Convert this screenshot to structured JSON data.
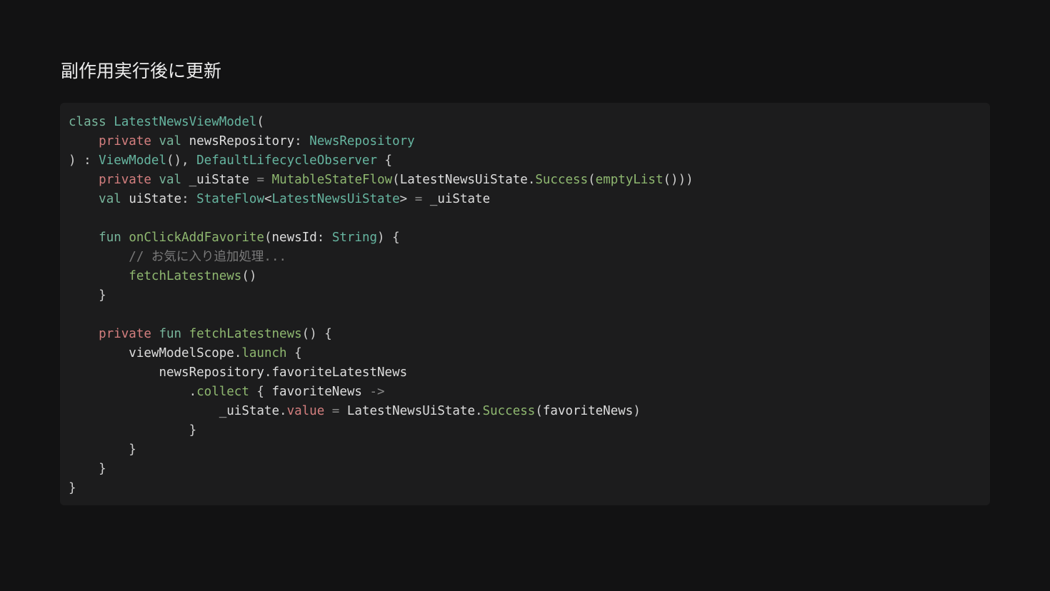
{
  "slide": {
    "title": "副作用実行後に更新"
  },
  "code": {
    "language": "kotlin",
    "colors": {
      "background": "#1c1c1d",
      "page_background": "#121213",
      "keyword_modifier": "#d47f7f",
      "keyword": "#77b59b",
      "type": "#66b5a0",
      "function": "#8fb870",
      "identifier": "#dedede",
      "operator": "#888888",
      "comment": "#7a7a7a"
    },
    "lines": [
      [
        {
          "t": "kw2",
          "v": "class"
        },
        {
          "t": "ws",
          "v": " "
        },
        {
          "t": "type",
          "v": "LatestNewsViewModel"
        },
        {
          "t": "punct",
          "v": "("
        }
      ],
      [
        {
          "t": "ws",
          "v": "    "
        },
        {
          "t": "kw",
          "v": "private"
        },
        {
          "t": "ws",
          "v": " "
        },
        {
          "t": "kw2",
          "v": "val"
        },
        {
          "t": "ws",
          "v": " "
        },
        {
          "t": "ident",
          "v": "newsRepository"
        },
        {
          "t": "punct",
          "v": ": "
        },
        {
          "t": "type",
          "v": "NewsRepository"
        }
      ],
      [
        {
          "t": "punct",
          "v": ") : "
        },
        {
          "t": "type",
          "v": "ViewModel"
        },
        {
          "t": "punct",
          "v": "(), "
        },
        {
          "t": "type",
          "v": "DefaultLifecycleObserver"
        },
        {
          "t": "punct",
          "v": " {"
        }
      ],
      [
        {
          "t": "ws",
          "v": "    "
        },
        {
          "t": "kw",
          "v": "private"
        },
        {
          "t": "ws",
          "v": " "
        },
        {
          "t": "kw2",
          "v": "val"
        },
        {
          "t": "ws",
          "v": " "
        },
        {
          "t": "ident",
          "v": "_uiState"
        },
        {
          "t": "ws",
          "v": " "
        },
        {
          "t": "op",
          "v": "="
        },
        {
          "t": "ws",
          "v": " "
        },
        {
          "t": "fn",
          "v": "MutableStateFlow"
        },
        {
          "t": "punct",
          "v": "("
        },
        {
          "t": "ident",
          "v": "LatestNewsUiState"
        },
        {
          "t": "punct",
          "v": "."
        },
        {
          "t": "fn",
          "v": "Success"
        },
        {
          "t": "punct",
          "v": "("
        },
        {
          "t": "fn",
          "v": "emptyList"
        },
        {
          "t": "punct",
          "v": "()))"
        }
      ],
      [
        {
          "t": "ws",
          "v": "    "
        },
        {
          "t": "kw2",
          "v": "val"
        },
        {
          "t": "ws",
          "v": " "
        },
        {
          "t": "ident",
          "v": "uiState"
        },
        {
          "t": "punct",
          "v": ": "
        },
        {
          "t": "type",
          "v": "StateFlow"
        },
        {
          "t": "punct",
          "v": "<"
        },
        {
          "t": "type",
          "v": "LatestNewsUiState"
        },
        {
          "t": "punct",
          "v": "> "
        },
        {
          "t": "op",
          "v": "="
        },
        {
          "t": "ws",
          "v": " "
        },
        {
          "t": "ident",
          "v": "_uiState"
        }
      ],
      [],
      [
        {
          "t": "ws",
          "v": "    "
        },
        {
          "t": "kw2",
          "v": "fun"
        },
        {
          "t": "ws",
          "v": " "
        },
        {
          "t": "fn",
          "v": "onClickAddFavorite"
        },
        {
          "t": "punct",
          "v": "("
        },
        {
          "t": "ident",
          "v": "newsId"
        },
        {
          "t": "punct",
          "v": ": "
        },
        {
          "t": "type",
          "v": "String"
        },
        {
          "t": "punct",
          "v": ") {"
        }
      ],
      [
        {
          "t": "ws",
          "v": "        "
        },
        {
          "t": "comment",
          "v": "// お気に入り追加処理..."
        }
      ],
      [
        {
          "t": "ws",
          "v": "        "
        },
        {
          "t": "fn",
          "v": "fetchLatestnews"
        },
        {
          "t": "punct",
          "v": "()"
        }
      ],
      [
        {
          "t": "ws",
          "v": "    "
        },
        {
          "t": "punct",
          "v": "}"
        }
      ],
      [],
      [
        {
          "t": "ws",
          "v": "    "
        },
        {
          "t": "kw",
          "v": "private"
        },
        {
          "t": "ws",
          "v": " "
        },
        {
          "t": "kw2",
          "v": "fun"
        },
        {
          "t": "ws",
          "v": " "
        },
        {
          "t": "fn",
          "v": "fetchLatestnews"
        },
        {
          "t": "punct",
          "v": "() {"
        }
      ],
      [
        {
          "t": "ws",
          "v": "        "
        },
        {
          "t": "ident",
          "v": "viewModelScope"
        },
        {
          "t": "punct",
          "v": "."
        },
        {
          "t": "fn",
          "v": "launch"
        },
        {
          "t": "punct",
          "v": " {"
        }
      ],
      [
        {
          "t": "ws",
          "v": "            "
        },
        {
          "t": "ident",
          "v": "newsRepository"
        },
        {
          "t": "punct",
          "v": "."
        },
        {
          "t": "ident",
          "v": "favoriteLatestNews"
        }
      ],
      [
        {
          "t": "ws",
          "v": "                "
        },
        {
          "t": "punct",
          "v": "."
        },
        {
          "t": "fn",
          "v": "collect"
        },
        {
          "t": "punct",
          "v": " { "
        },
        {
          "t": "ident",
          "v": "favoriteNews"
        },
        {
          "t": "ws",
          "v": " "
        },
        {
          "t": "op",
          "v": "->"
        }
      ],
      [
        {
          "t": "ws",
          "v": "                    "
        },
        {
          "t": "ident",
          "v": "_uiState"
        },
        {
          "t": "punct",
          "v": "."
        },
        {
          "t": "kw",
          "v": "value"
        },
        {
          "t": "ws",
          "v": " "
        },
        {
          "t": "op",
          "v": "="
        },
        {
          "t": "ws",
          "v": " "
        },
        {
          "t": "ident",
          "v": "LatestNewsUiState"
        },
        {
          "t": "punct",
          "v": "."
        },
        {
          "t": "fn",
          "v": "Success"
        },
        {
          "t": "punct",
          "v": "("
        },
        {
          "t": "ident",
          "v": "favoriteNews"
        },
        {
          "t": "punct",
          "v": ")"
        }
      ],
      [
        {
          "t": "ws",
          "v": "                "
        },
        {
          "t": "punct",
          "v": "}"
        }
      ],
      [
        {
          "t": "ws",
          "v": "        "
        },
        {
          "t": "punct",
          "v": "}"
        }
      ],
      [
        {
          "t": "ws",
          "v": "    "
        },
        {
          "t": "punct",
          "v": "}"
        }
      ],
      [
        {
          "t": "punct",
          "v": "}"
        }
      ]
    ]
  }
}
